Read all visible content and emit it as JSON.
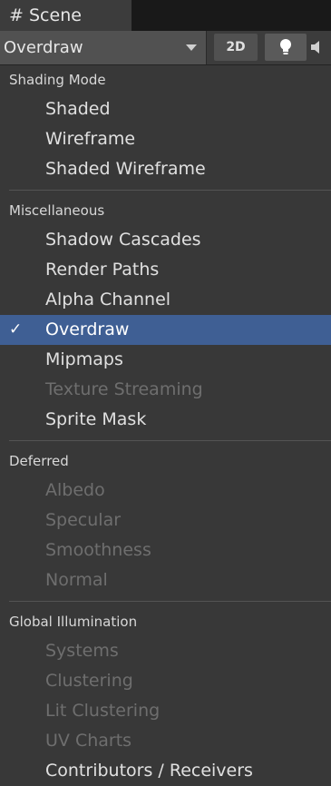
{
  "tab": {
    "title": "Scene",
    "icon": "hash-icon"
  },
  "toolbar": {
    "draw_mode_value": "Overdraw",
    "btn_2d": "2D",
    "lighting_icon": "bulb-icon",
    "audio_icon": "speaker-icon"
  },
  "menu": {
    "sections": [
      {
        "header": "Shading Mode",
        "items": [
          {
            "label": "Shaded",
            "disabled": false,
            "selected": false
          },
          {
            "label": "Wireframe",
            "disabled": false,
            "selected": false
          },
          {
            "label": "Shaded Wireframe",
            "disabled": false,
            "selected": false
          }
        ]
      },
      {
        "header": "Miscellaneous",
        "items": [
          {
            "label": "Shadow Cascades",
            "disabled": false,
            "selected": false
          },
          {
            "label": "Render Paths",
            "disabled": false,
            "selected": false
          },
          {
            "label": "Alpha Channel",
            "disabled": false,
            "selected": false
          },
          {
            "label": "Overdraw",
            "disabled": false,
            "selected": true
          },
          {
            "label": "Mipmaps",
            "disabled": false,
            "selected": false
          },
          {
            "label": "Texture Streaming",
            "disabled": true,
            "selected": false
          },
          {
            "label": "Sprite Mask",
            "disabled": false,
            "selected": false
          }
        ]
      },
      {
        "header": "Deferred",
        "items": [
          {
            "label": "Albedo",
            "disabled": true,
            "selected": false
          },
          {
            "label": "Specular",
            "disabled": true,
            "selected": false
          },
          {
            "label": "Smoothness",
            "disabled": true,
            "selected": false
          },
          {
            "label": "Normal",
            "disabled": true,
            "selected": false
          }
        ]
      },
      {
        "header": "Global Illumination",
        "items": [
          {
            "label": "Systems",
            "disabled": true,
            "selected": false
          },
          {
            "label": "Clustering",
            "disabled": true,
            "selected": false
          },
          {
            "label": "Lit Clustering",
            "disabled": true,
            "selected": false
          },
          {
            "label": "UV Charts",
            "disabled": true,
            "selected": false
          },
          {
            "label": "Contributors / Receivers",
            "disabled": false,
            "selected": false
          }
        ]
      }
    ]
  },
  "colors": {
    "selected_bg": "#3f5f94",
    "menu_bg": "#383838",
    "disabled_text": "#6e6e6e"
  }
}
